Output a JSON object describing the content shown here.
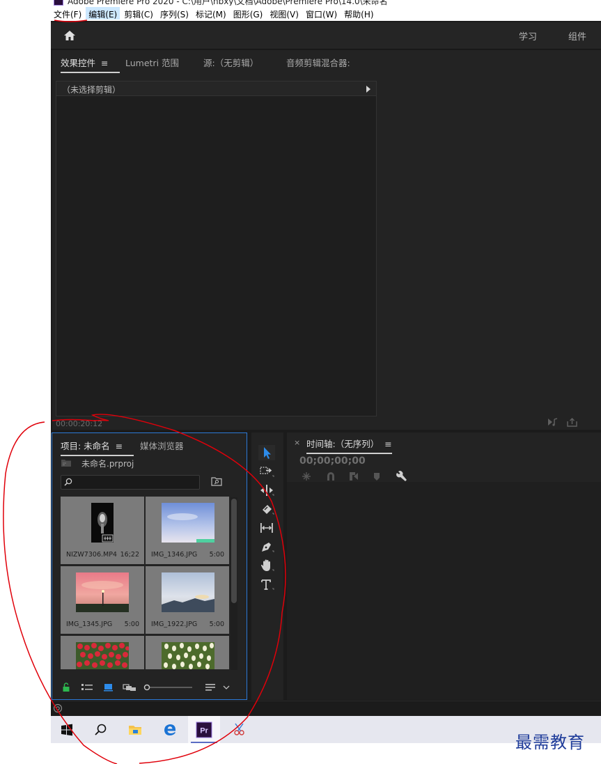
{
  "window": {
    "title": "Adobe Premiere Pro 2020 - C:\\用户\\hbxy\\文档\\Adobe\\Premiere Pro\\14.0\\未命名"
  },
  "menu": [
    {
      "label": "文件(F)"
    },
    {
      "label": "编辑(E)"
    },
    {
      "label": "剪辑(C)"
    },
    {
      "label": "序列(S)"
    },
    {
      "label": "标记(M)"
    },
    {
      "label": "图形(G)"
    },
    {
      "label": "视图(V)"
    },
    {
      "label": "窗口(W)"
    },
    {
      "label": "帮助(H)"
    }
  ],
  "header": {
    "workspaces": [
      "学习",
      "组件"
    ]
  },
  "upper_panel": {
    "tabs": [
      "效果控件",
      "Lumetri 范围",
      "源:（无剪辑）",
      "音频剪辑混合器:"
    ],
    "no_clip_label": "（未选择剪辑）",
    "timecode": "00:00:20:12"
  },
  "project_panel": {
    "tabs": [
      "项目: 未命名",
      "媒体浏览器"
    ],
    "project_file": "未命名.prproj",
    "search": {
      "value": "",
      "placeholder": ""
    },
    "items": [
      {
        "name": "NIZW7306.MP4",
        "duration": "16;22"
      },
      {
        "name": "IMG_1346.JPG",
        "duration": "5:00"
      },
      {
        "name": "IMG_1345.JPG",
        "duration": "5:00"
      },
      {
        "name": "IMG_1922.JPG",
        "duration": "5:00"
      },
      {
        "name": "",
        "duration": ""
      },
      {
        "name": "",
        "duration": ""
      }
    ]
  },
  "timeline_panel": {
    "title": "时间轴:（无序列）",
    "timecode": "00;00;00;00"
  },
  "watermark": "最需教育",
  "colors": {
    "accent": "#2d7ad8",
    "tool_active": "#2d8ceb",
    "annotation": "#e0000a"
  }
}
